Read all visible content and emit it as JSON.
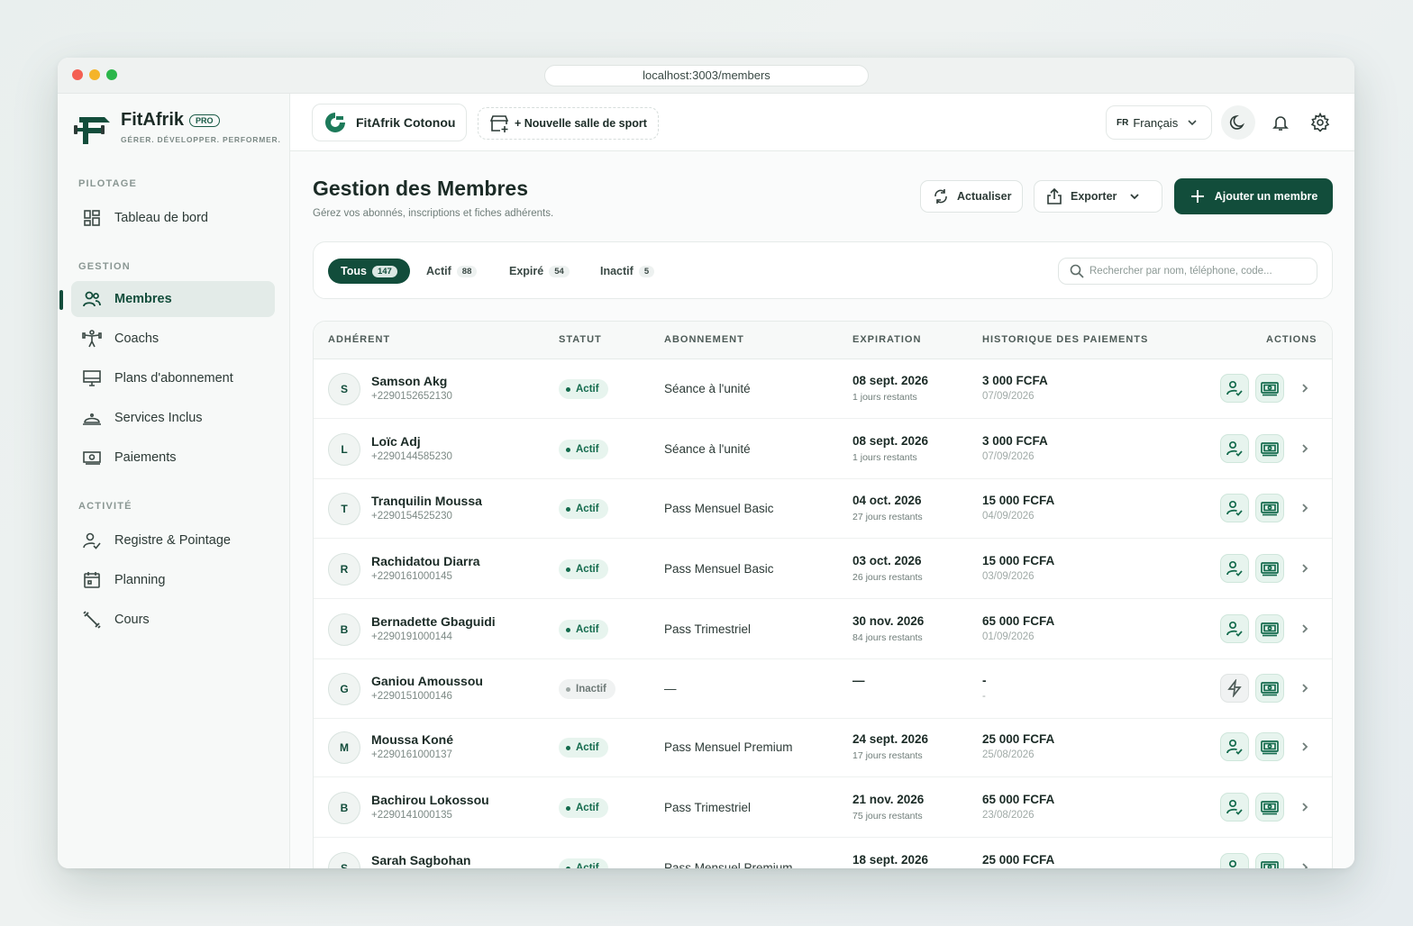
{
  "browser": {
    "url": "localhost:3003/members"
  },
  "brand": {
    "name": "FitAfrik",
    "badge": "PRO",
    "tagline": "GÉRER. DÉVELOPPER. PERFORMER."
  },
  "sidebar": {
    "sections": [
      {
        "label": "PILOTAGE",
        "items": [
          {
            "label": "Tableau de bord",
            "icon": "dashboard-icon"
          }
        ]
      },
      {
        "label": "GESTION",
        "items": [
          {
            "label": "Membres",
            "icon": "users-icon",
            "active": true
          },
          {
            "label": "Coachs",
            "icon": "coach-icon"
          },
          {
            "label": "Plans d'abonnement",
            "icon": "monitor-icon"
          },
          {
            "label": "Services Inclus",
            "icon": "service-icon"
          },
          {
            "label": "Paiements",
            "icon": "cash-icon"
          }
        ]
      },
      {
        "label": "ACTIVITÉ",
        "items": [
          {
            "label": "Registre & Pointage",
            "icon": "user-check-icon"
          },
          {
            "label": "Planning",
            "icon": "calendar-icon"
          },
          {
            "label": "Cours",
            "icon": "dumbbell-icon"
          }
        ]
      }
    ]
  },
  "topbar": {
    "gym_name": "FitAfrik Cotonou",
    "new_gym_label": "+ Nouvelle salle de sport",
    "language_code": "FR",
    "language_label": "Français"
  },
  "page": {
    "title": "Gestion des Membres",
    "subtitle": "Gérez vos abonnés, inscriptions et fiches adhérents.",
    "refresh_label": "Actualiser",
    "export_label": "Exporter",
    "add_label": "Ajouter un membre"
  },
  "filters": {
    "tabs": [
      {
        "label": "Tous",
        "count": "147",
        "active": true
      },
      {
        "label": "Actif",
        "count": "88"
      },
      {
        "label": "Expiré",
        "count": "54"
      },
      {
        "label": "Inactif",
        "count": "5"
      }
    ],
    "search_placeholder": "Rechercher par nom, téléphone, code..."
  },
  "table": {
    "headers": [
      "ADHÉRENT",
      "STATUT",
      "ABONNEMENT",
      "EXPIRATION",
      "HISTORIQUE DES PAIEMENTS",
      "ACTIONS"
    ],
    "rows": [
      {
        "initial": "S",
        "name": "Samson Akg",
        "phone": "+2290152652130",
        "status": "Actif",
        "plan": "Séance à l'unité",
        "exp_date": "08 sept. 2026",
        "exp_remaining": "1 jours restants",
        "pay_amount": "3 000 FCFA",
        "pay_date": "07/09/2026",
        "first_action": "checkin"
      },
      {
        "initial": "L",
        "name": "Loïc Adj",
        "phone": "+2290144585230",
        "status": "Actif",
        "plan": "Séance à l'unité",
        "exp_date": "08 sept. 2026",
        "exp_remaining": "1 jours restants",
        "pay_amount": "3 000 FCFA",
        "pay_date": "07/09/2026",
        "first_action": "checkin"
      },
      {
        "initial": "T",
        "name": "Tranquilin Moussa",
        "phone": "+2290154525230",
        "status": "Actif",
        "plan": "Pass Mensuel Basic",
        "exp_date": "04 oct. 2026",
        "exp_remaining": "27 jours restants",
        "pay_amount": "15 000 FCFA",
        "pay_date": "04/09/2026",
        "first_action": "checkin"
      },
      {
        "initial": "R",
        "name": "Rachidatou Diarra",
        "phone": "+2290161000145",
        "status": "Actif",
        "plan": "Pass Mensuel Basic",
        "exp_date": "03 oct. 2026",
        "exp_remaining": "26 jours restants",
        "pay_amount": "15 000 FCFA",
        "pay_date": "03/09/2026",
        "first_action": "checkin"
      },
      {
        "initial": "B",
        "name": "Bernadette Gbaguidi",
        "phone": "+2290191000144",
        "status": "Actif",
        "plan": "Pass Trimestriel",
        "exp_date": "30 nov. 2026",
        "exp_remaining": "84 jours restants",
        "pay_amount": "65 000 FCFA",
        "pay_date": "01/09/2026",
        "first_action": "checkin"
      },
      {
        "initial": "G",
        "name": "Ganiou Amoussou",
        "phone": "+2290151000146",
        "status": "Inactif",
        "plan": "—",
        "exp_date": "—",
        "exp_remaining": "",
        "pay_amount": "-",
        "pay_date": "-",
        "first_action": "activate"
      },
      {
        "initial": "M",
        "name": "Moussa Koné",
        "phone": "+2290161000137",
        "status": "Actif",
        "plan": "Pass Mensuel Premium",
        "exp_date": "24 sept. 2026",
        "exp_remaining": "17 jours restants",
        "pay_amount": "25 000 FCFA",
        "pay_date": "25/08/2026",
        "first_action": "checkin"
      },
      {
        "initial": "B",
        "name": "Bachirou Lokossou",
        "phone": "+2290141000135",
        "status": "Actif",
        "plan": "Pass Trimestriel",
        "exp_date": "21 nov. 2026",
        "exp_remaining": "75 jours restants",
        "pay_amount": "65 000 FCFA",
        "pay_date": "23/08/2026",
        "first_action": "checkin"
      },
      {
        "initial": "S",
        "name": "Sarah Sagbohan",
        "phone": "",
        "status": "Actif",
        "plan": "Pass Mensuel Premium",
        "exp_date": "18 sept. 2026",
        "exp_remaining": "",
        "pay_amount": "25 000 FCFA",
        "pay_date": "",
        "first_action": "checkin"
      }
    ]
  },
  "colors": {
    "primary": "#124d3b",
    "active_badge_bg": "#e7f4ee",
    "active_badge_text": "#146b4d"
  }
}
